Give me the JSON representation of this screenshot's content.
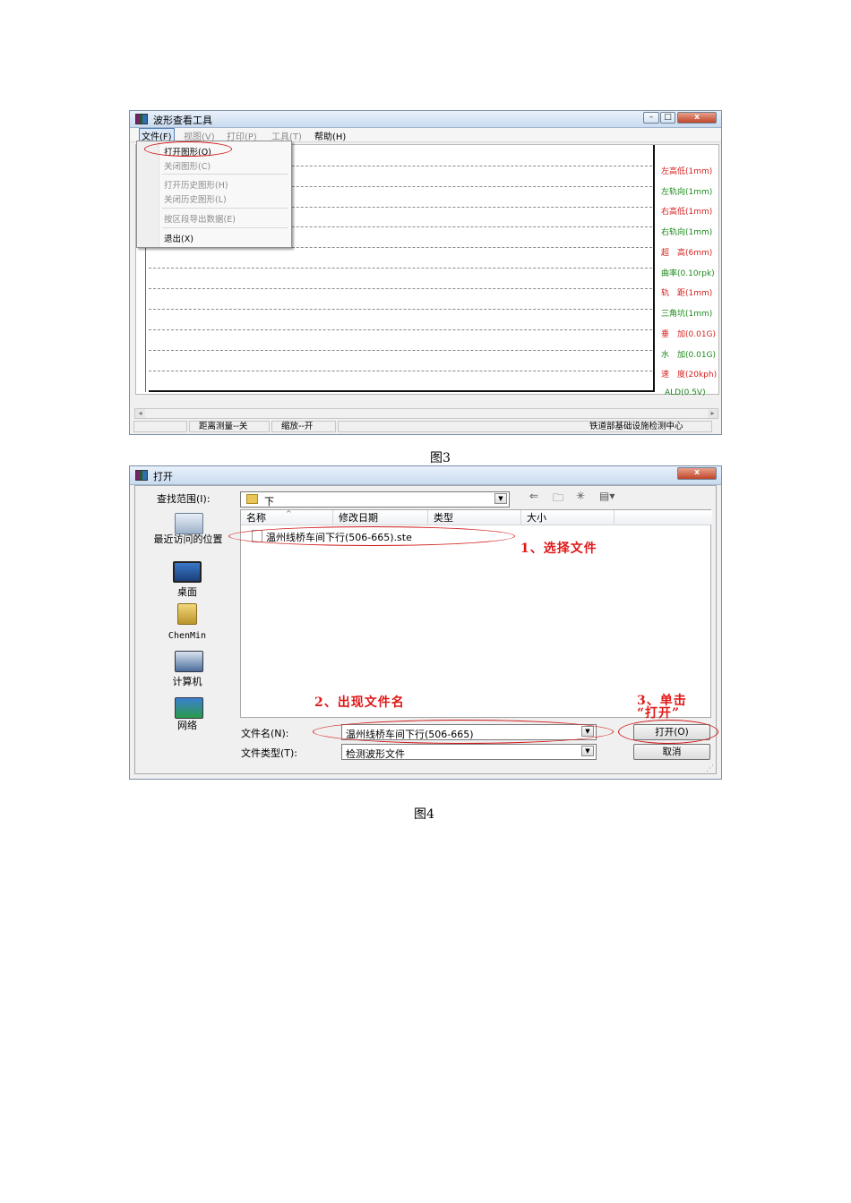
{
  "figure3": {
    "window_title": "波形查看工具",
    "menus": [
      "文件(F)",
      "视图(V)",
      "打印(P)",
      "工具(T)",
      "帮助(H)"
    ],
    "file_menu": {
      "items": [
        "打开图形(O)",
        "关闭图形(C)",
        "打开历史图形(H)",
        "关闭历史图形(L)",
        "按区段导出数据(E)",
        "退出(X)"
      ]
    },
    "channels": [
      {
        "label": "左高低(1mm)",
        "color": "#d62020"
      },
      {
        "label": "左轨向(1mm)",
        "color": "#1a8a1a"
      },
      {
        "label": "右高低(1mm)",
        "color": "#d62020"
      },
      {
        "label": "右轨向(1mm)",
        "color": "#1a8a1a"
      },
      {
        "label": "超　高(6mm)",
        "color": "#d62020"
      },
      {
        "label": "曲率(0.10rpk)",
        "color": "#1a8a1a"
      },
      {
        "label": "轨　距(1mm)",
        "color": "#d62020"
      },
      {
        "label": "三角坑(1mm)",
        "color": "#1a8a1a"
      },
      {
        "label": "垂　加(0.01G)",
        "color": "#d62020"
      },
      {
        "label": "水　加(0.01G)",
        "color": "#1a8a1a"
      },
      {
        "label": "速　度(20kph)",
        "color": "#d62020"
      },
      {
        "label": "ALD(0.5V)",
        "color": "#1a8a1a"
      }
    ],
    "status": {
      "distance": "距离测量--关",
      "zoom": "缩放--开",
      "org": "铁道部基础设施检测中心"
    },
    "caption": "图3"
  },
  "figure4": {
    "window_title": "打开",
    "look_in_label": "查找范围(I):",
    "look_in_value": "下",
    "places": [
      "最近访问的位置",
      "桌面",
      "ChenMin",
      "计算机",
      "网络"
    ],
    "columns": [
      "名称",
      "修改日期",
      "类型",
      "大小"
    ],
    "files": [
      "温州线桥车间下行(506-665).ste"
    ],
    "filename_label": "文件名(N):",
    "filename_value": "温州线桥车间下行(506-665)",
    "filetype_label": "文件类型(T):",
    "filetype_value": "检测波形文件",
    "open_button": "打开(O)",
    "cancel_button": "取消",
    "annotations": {
      "step1": "1、选择文件",
      "step2": "2、出现文件名",
      "step3_line1": "3、单击",
      "step3_line2": "“打开”"
    },
    "caption": "图4"
  }
}
